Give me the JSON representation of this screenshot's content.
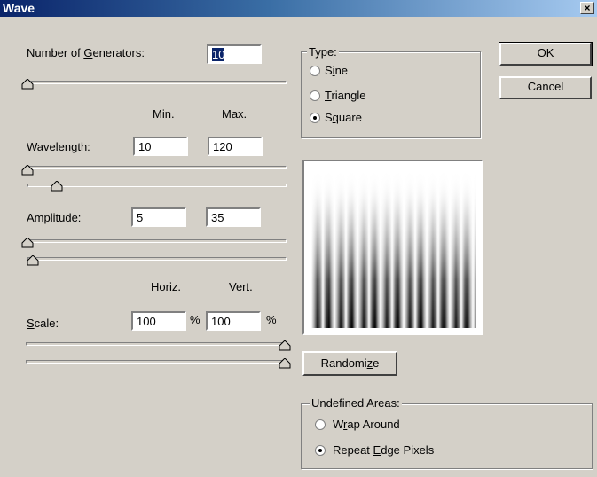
{
  "window": {
    "title": "Wave",
    "close_symbol": "×"
  },
  "generators": {
    "label": "Number of Generators:",
    "value": "10",
    "slider_level": 0.0
  },
  "columns": {
    "min": "Min.",
    "max": "Max.",
    "horiz": "Horiz.",
    "vert": "Vert."
  },
  "wavelength": {
    "label": "Wavelength:",
    "min": "10",
    "max": "120",
    "min_slider": 0.0,
    "max_slider": 0.12
  },
  "amplitude": {
    "label": "Amplitude:",
    "min": "5",
    "max": "35",
    "min_slider": 0.0,
    "max_slider": 0.03
  },
  "scale": {
    "label": "Scale:",
    "horiz": "100",
    "vert": "100",
    "unit": "%",
    "horiz_slider": 1.0,
    "vert_slider": 1.0
  },
  "type": {
    "legend": "Type:",
    "options": [
      "Sine",
      "Triangle",
      "Square"
    ],
    "selected": "Square"
  },
  "buttons": {
    "ok": "OK",
    "cancel": "Cancel",
    "randomize": "Randomize"
  },
  "undefined_areas": {
    "legend": "Undefined Areas:",
    "options": [
      "Wrap Around",
      "Repeat Edge Pixels"
    ],
    "selected": "Repeat Edge Pixels"
  }
}
